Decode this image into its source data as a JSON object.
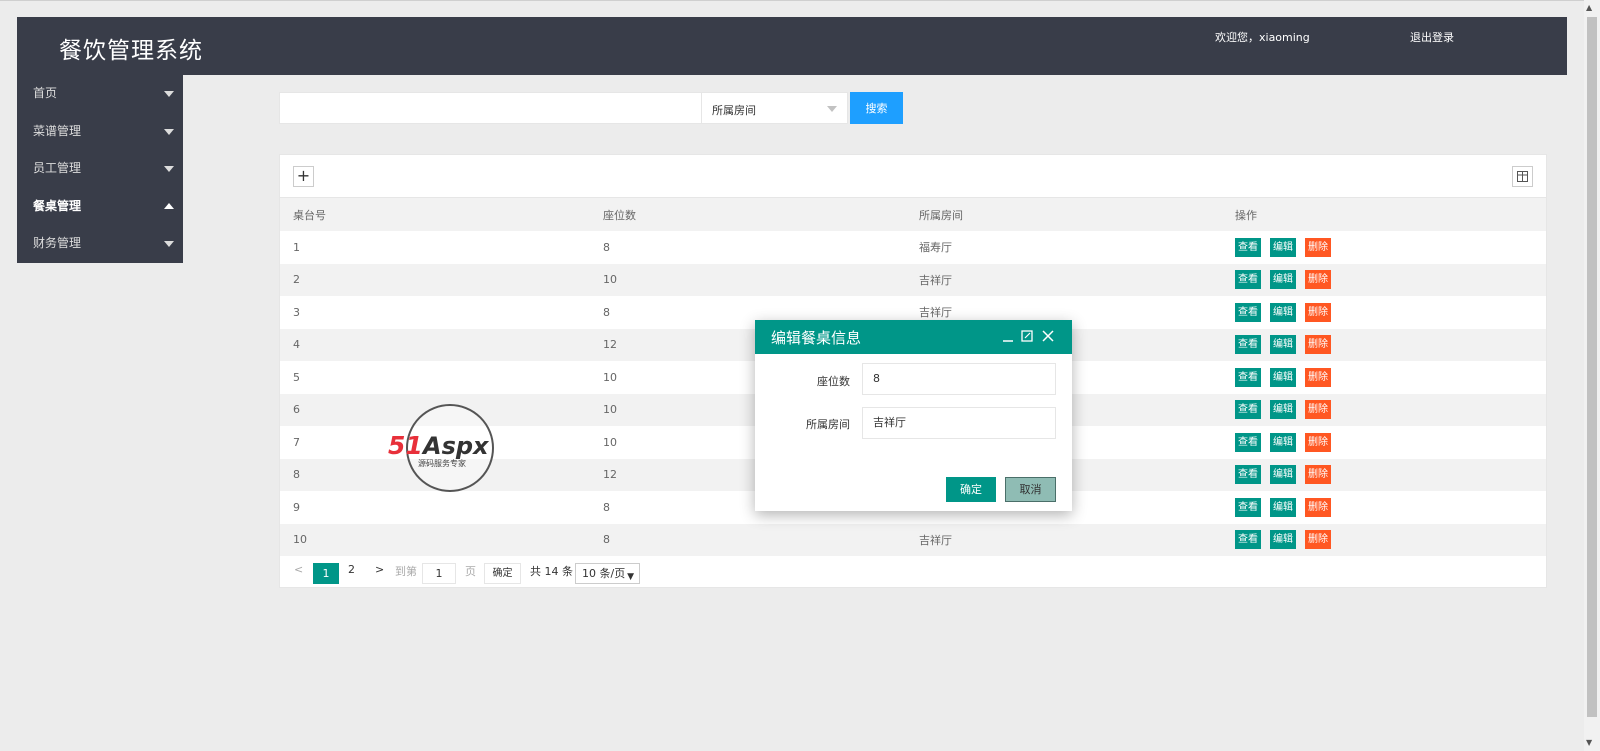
{
  "header": {
    "title": "餐饮管理系统",
    "welcome": "欢迎您，xiaoming",
    "logout": "退出登录"
  },
  "sidebar": {
    "items": [
      {
        "label": "首页",
        "expanded": false
      },
      {
        "label": "菜谱管理",
        "expanded": false
      },
      {
        "label": "员工管理",
        "expanded": false
      },
      {
        "label": "餐桌管理",
        "expanded": true
      },
      {
        "label": "财务管理",
        "expanded": false
      }
    ]
  },
  "search": {
    "value": "",
    "room_select": "所属房间",
    "button": "搜索"
  },
  "toolbar": {
    "add_label": "+"
  },
  "table": {
    "headers": [
      "桌台号",
      "座位数",
      "所属房间",
      "操作"
    ],
    "rows": [
      {
        "id": "1",
        "seats": "8",
        "room": "福寿厅"
      },
      {
        "id": "2",
        "seats": "10",
        "room": "吉祥厅"
      },
      {
        "id": "3",
        "seats": "8",
        "room": "吉祥厅"
      },
      {
        "id": "4",
        "seats": "12",
        "room": ""
      },
      {
        "id": "5",
        "seats": "10",
        "room": ""
      },
      {
        "id": "6",
        "seats": "10",
        "room": ""
      },
      {
        "id": "7",
        "seats": "10",
        "room": ""
      },
      {
        "id": "8",
        "seats": "12",
        "room": ""
      },
      {
        "id": "9",
        "seats": "8",
        "room": ""
      },
      {
        "id": "10",
        "seats": "8",
        "room": "吉祥厅"
      }
    ],
    "ops": {
      "view": "查看",
      "edit": "编辑",
      "delete": "删除"
    }
  },
  "pager": {
    "prev": "<",
    "page1": "1",
    "page2": "2",
    "next": ">",
    "goto_label": "到第",
    "goto_value": "1",
    "page_unit": "页",
    "confirm": "确定",
    "total": "共 14 条",
    "page_size": "10 条/页"
  },
  "modal": {
    "title": "编辑餐桌信息",
    "seats_label": "座位数",
    "seats_value": "8",
    "room_label": "所属房间",
    "room_value": "吉祥厅",
    "ok": "确定",
    "cancel": "取消"
  },
  "watermark": {
    "brand": "51Aspx",
    "slogan": "源码服务专家"
  },
  "colors": {
    "header_bg": "#393d49",
    "primary": "#009688",
    "search_blue": "#1e9fff",
    "danger": "#ff5722"
  }
}
